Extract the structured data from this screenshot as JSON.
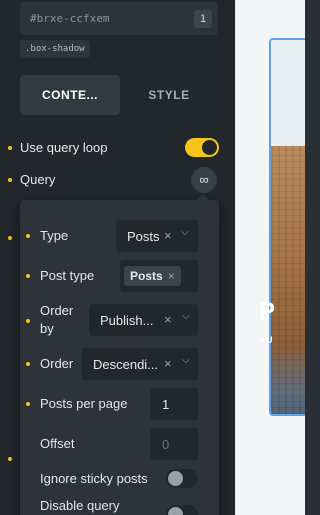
{
  "element": {
    "id": "#brxe-ccfxem",
    "id_count": "1",
    "class_chip": ".box-shadow"
  },
  "tabs": {
    "content": "CONTE...",
    "style": "STYLE"
  },
  "controls": {
    "use_query_loop": {
      "label": "Use query loop",
      "enabled": true
    },
    "query": {
      "label": "Query",
      "icon": "infinity-icon"
    }
  },
  "query_popup": {
    "type": {
      "label": "Type",
      "value": "Posts"
    },
    "post_type": {
      "label": "Post type",
      "tag": "Posts"
    },
    "order_by": {
      "label_line1": "Order",
      "label_line2": "by",
      "value": "Publish..."
    },
    "order": {
      "label": "Order",
      "value": "Descendi..."
    },
    "posts_per_page": {
      "label": "Posts per page",
      "value": "1"
    },
    "offset": {
      "label": "Offset",
      "placeholder": "0"
    },
    "ignore_sticky": {
      "label": "Ignore sticky posts",
      "enabled": false
    },
    "disable_query": {
      "label": "Disable query",
      "enabled": false
    }
  },
  "preview": {
    "title": "P",
    "subtitle": "AU"
  },
  "colors": {
    "accent": "#f5c518",
    "panel": "#22272c",
    "popup": "#2d3339",
    "selection": "#5fa3e6"
  }
}
